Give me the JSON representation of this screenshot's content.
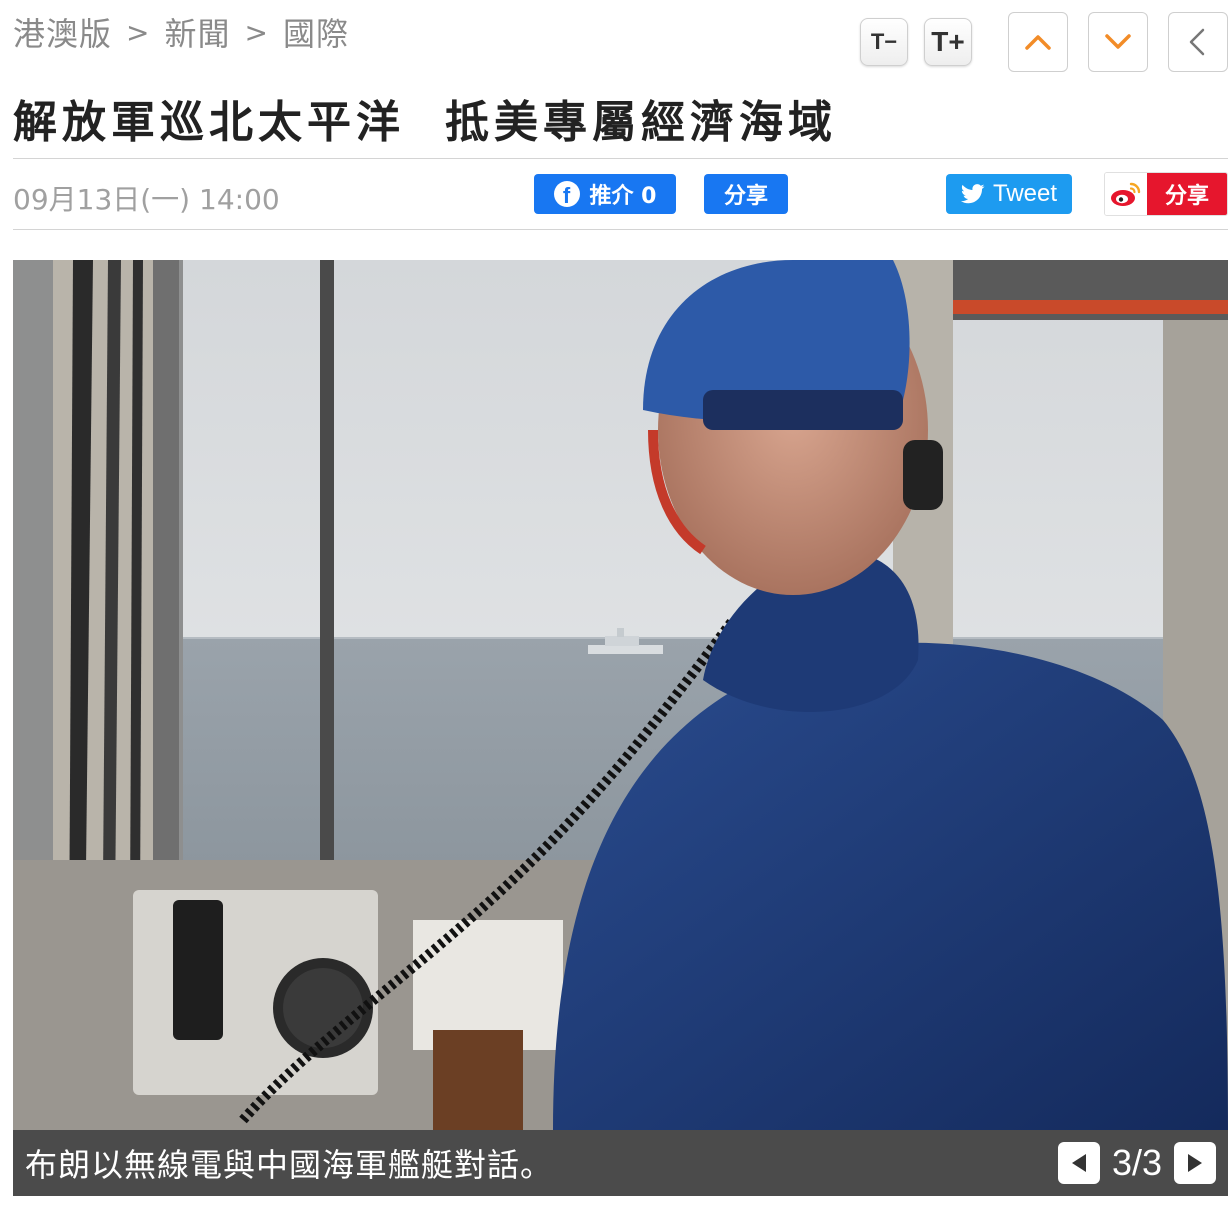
{
  "breadcrumb": {
    "items": [
      "港澳版",
      "新聞",
      "國際"
    ],
    "separator": ">"
  },
  "toolbar": {
    "font_decrease": "T−",
    "font_increase": "T+",
    "icons": [
      "chevron-up-icon",
      "chevron-down-icon",
      "chevron-left-icon"
    ],
    "accent_color": "#f28c28"
  },
  "article": {
    "title_part1": "解放軍巡北太平洋",
    "title_part2": "抵美專屬經濟海域",
    "date": "09月13日(一) 14:00"
  },
  "social": {
    "fb_like_label": "推介 0",
    "fb_share_label": "分享",
    "tweet_label": "Tweet",
    "weibo_label": "分享",
    "colors": {
      "facebook": "#1877f2",
      "twitter": "#1d9bf0",
      "weibo": "#e6162d"
    }
  },
  "gallery": {
    "caption": "布朗以無線電與中國海軍艦艇對話。",
    "counter": "3/3"
  }
}
